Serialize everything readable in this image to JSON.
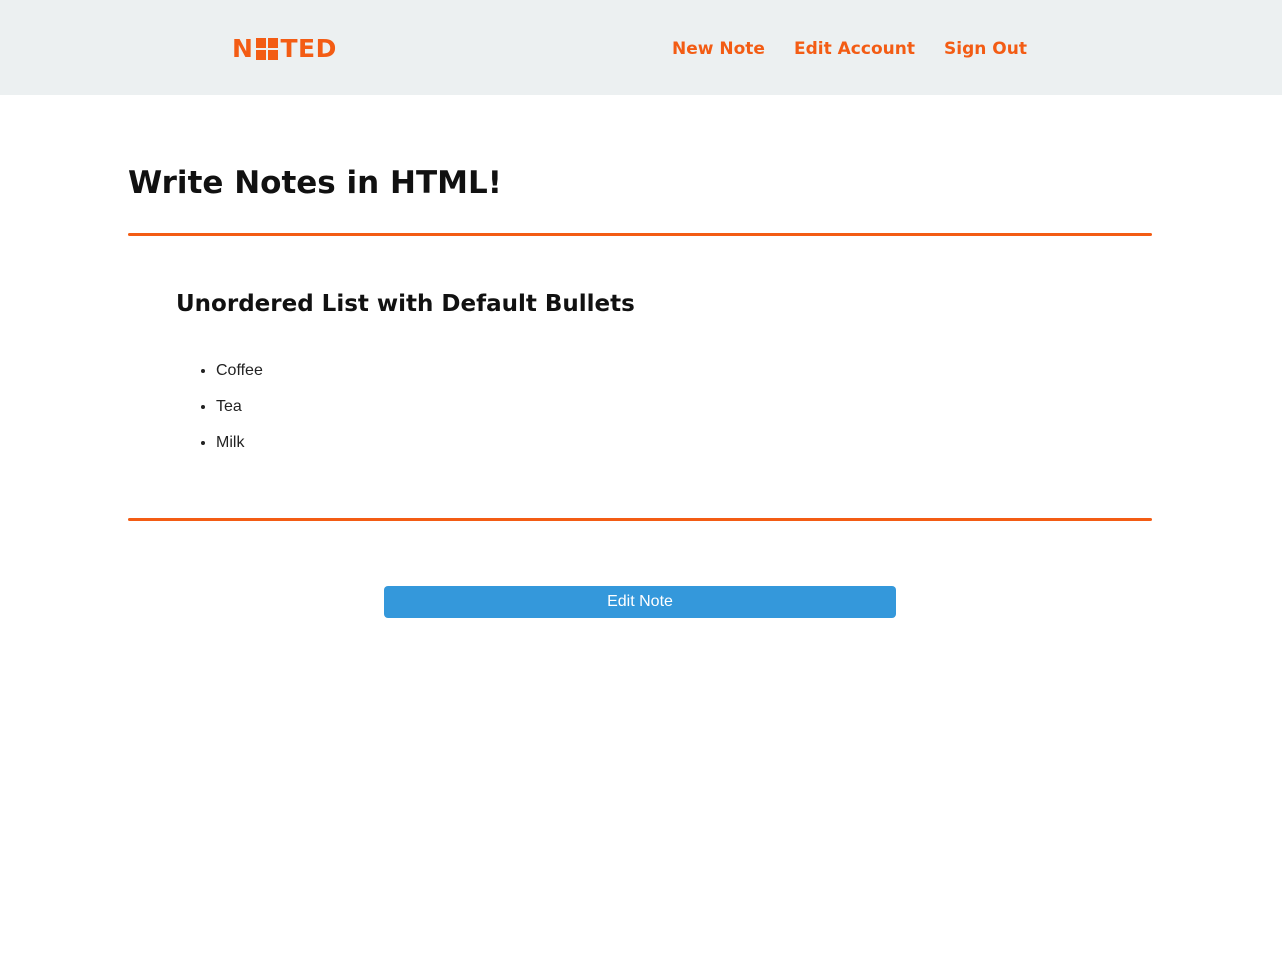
{
  "header": {
    "logo_text_left": "N",
    "logo_text_right": "TED",
    "nav": {
      "new_note": "New Note",
      "edit_account": "Edit Account",
      "sign_out": "Sign Out"
    }
  },
  "main": {
    "title": "Write Notes in HTML!",
    "note": {
      "heading": "Unordered List with Default Bullets",
      "items": [
        "Coffee",
        "Tea",
        "Milk"
      ]
    },
    "edit_button_label": "Edit Note"
  },
  "colors": {
    "accent": "#f35c14",
    "header_bg": "#ecf0f1",
    "button_bg": "#3498db"
  },
  "icons": {
    "logo_mark": "grid-icon"
  }
}
